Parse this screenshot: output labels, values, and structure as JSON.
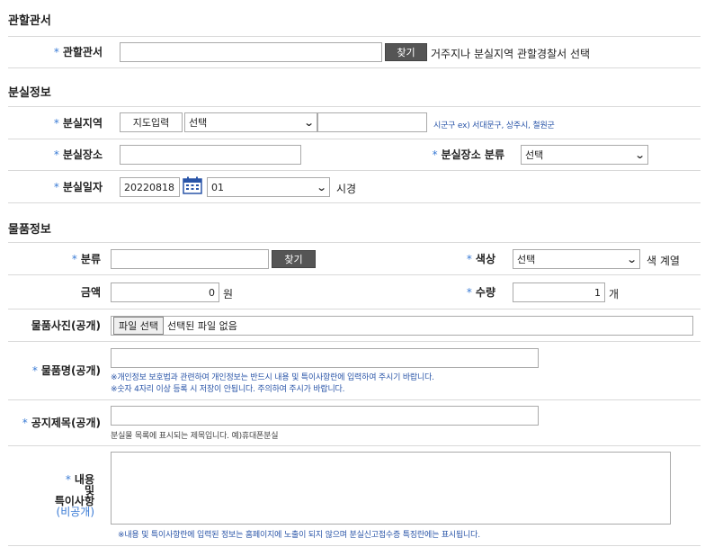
{
  "sections": {
    "jurisdiction": "관할관서",
    "loss_info": "분실정보",
    "item_info": "물품정보"
  },
  "jurisdiction": {
    "label": "관할관서",
    "value": "",
    "search_button": "찾기",
    "hint": "거주지나 분실지역 관할경찰서 선택"
  },
  "loss": {
    "area_label": "분실지역",
    "map_button": "지도입력",
    "area_select": "선택",
    "area_text": "",
    "area_hint": "시군구 ex) 서대문구, 상주시, 철원군",
    "place_label": "분실장소",
    "place_value": "",
    "place_type_label": "분실장소 분류",
    "place_type_select": "선택",
    "date_label": "분실일자",
    "date_value": "20220818",
    "hour_select": "01",
    "hour_suffix": "시경"
  },
  "item": {
    "category_label": "분류",
    "category_value": "",
    "category_button": "찾기",
    "color_label": "색상",
    "color_select": "선택",
    "color_suffix": "색 계열",
    "amount_label": "금액",
    "amount_value": "0",
    "amount_unit": "원",
    "qty_label": "수량",
    "qty_value": "1",
    "qty_unit": "개",
    "photo_label": "물품사진(공개)",
    "photo_button": "파일 선택",
    "photo_status": "선택된 파일 없음",
    "name_label": "물품명(공개)",
    "name_value": "",
    "name_note1": "※개인정보 보호법과 관련하여 개인정보는 반드시 내용 및 특이사항란에 입력하여 주시기 바랍니다.",
    "name_note2": "※숫자 4자리 이상 등록 시 저장이 안됩니다. 주의하여 주시가 바랍니다.",
    "title_label": "공지제목(공개)",
    "title_value": "",
    "title_note": "분실물 목록에 표시되는 제목입니다. 예)휴대폰분실",
    "content_label_1": "내용",
    "content_label_2": "및",
    "content_label_3": "특이사항",
    "content_label_4": "(비공개)",
    "content_value": "",
    "content_note": "※내용 및 특이사항란에 입력된 정보는 홈페이지에 노출이 되지 않으며 분실신고접수증 특징란에는 표시됩니다."
  },
  "required_mark": "*",
  "colors": {
    "accent": "#3a7bd5",
    "dark_button": "#555555",
    "border": "#d9d9d9"
  }
}
